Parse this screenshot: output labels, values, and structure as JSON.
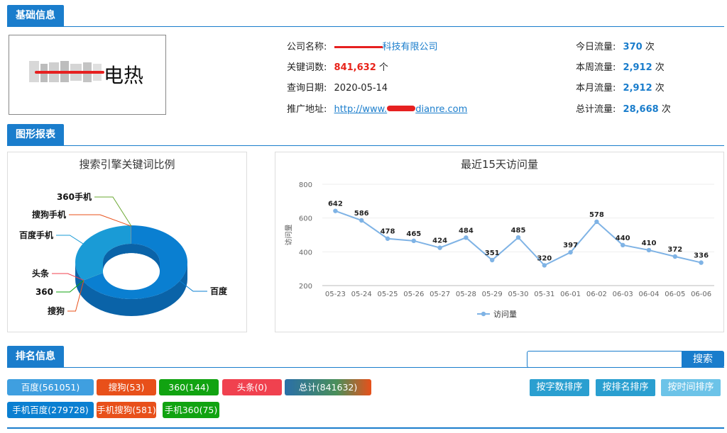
{
  "sections": {
    "basic": "基础信息",
    "charts": "图形报表",
    "ranking": "排名信息"
  },
  "logo": {
    "text": "电热"
  },
  "info": {
    "company_label": "公司名称:",
    "company_value": "科技有限公司",
    "keywords_label": "关键词数:",
    "keywords_value": "841,632",
    "keywords_unit": "个",
    "date_label": "查询日期:",
    "date_value": "2020-05-14",
    "url_label": "推广地址:",
    "url_prefix": "http://www.",
    "url_suffix": "dianre.com"
  },
  "traffic": [
    {
      "label": "今日流量:",
      "value": "370",
      "unit": "次"
    },
    {
      "label": "本周流量:",
      "value": "2,912",
      "unit": "次"
    },
    {
      "label": "本月流量:",
      "value": "2,912",
      "unit": "次"
    },
    {
      "label": "总计流量:",
      "value": "28,668",
      "unit": "次"
    }
  ],
  "chart_data": [
    {
      "type": "pie",
      "title": "搜索引擎关键词比例",
      "slices": [
        {
          "name": "百度",
          "value": 561051,
          "color": "#0a7fd1"
        },
        {
          "name": "搜狗",
          "value": 53,
          "color": "#e8501a"
        },
        {
          "name": "360",
          "value": 144,
          "color": "#11a311"
        },
        {
          "name": "头条",
          "value": 0,
          "color": "#f0414f"
        },
        {
          "name": "百度手机",
          "value": 279728,
          "color": "#1a9bd6"
        },
        {
          "name": "搜狗手机",
          "value": 581,
          "color": "#e8501a"
        },
        {
          "name": "360手机",
          "value": 75,
          "color": "#6aa832"
        }
      ]
    },
    {
      "type": "line",
      "title": "最近15天访问量",
      "ylabel": "访问量",
      "ylim": [
        200,
        800
      ],
      "yticks": [
        200,
        400,
        600,
        800
      ],
      "categories": [
        "05-23",
        "05-24",
        "05-25",
        "05-26",
        "05-27",
        "05-28",
        "05-29",
        "05-30",
        "05-31",
        "06-01",
        "06-02",
        "06-03",
        "06-04",
        "06-05",
        "06-06"
      ],
      "series": [
        {
          "name": "访问量",
          "values": [
            642,
            586,
            478,
            465,
            424,
            484,
            351,
            485,
            320,
            397,
            578,
            440,
            410,
            372,
            336
          ],
          "color": "#7fb3e5"
        }
      ],
      "legend": "bottom"
    }
  ],
  "search": {
    "button": "搜索",
    "placeholder": ""
  },
  "tags": [
    {
      "label": "百度(561051)",
      "color": "#3f9fe0"
    },
    {
      "label": "搜狗(53)",
      "color": "#e8501a"
    },
    {
      "label": "360(144)",
      "color": "#11a311"
    },
    {
      "label": "头条(0)",
      "color": "#f0414f"
    },
    {
      "label": "总计(841632)",
      "color": "#2a6fa8"
    },
    {
      "label": "手机百度(279728)",
      "color": "#0a7fd1"
    },
    {
      "label": "手机搜狗(581)",
      "color": "#e8501a"
    },
    {
      "label": "手机360(75)",
      "color": "#11a311"
    }
  ],
  "sort_buttons": [
    {
      "label": "按字数排序",
      "color": "#2a9fd0"
    },
    {
      "label": "按排名排序",
      "color": "#2a9fd0"
    },
    {
      "label": "按时间排序",
      "color": "#6cc3e8"
    }
  ]
}
